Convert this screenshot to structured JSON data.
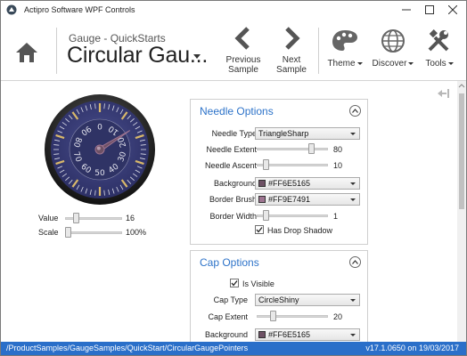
{
  "window": {
    "title": "Actipro Software WPF Controls",
    "icon": "actipro-logo-icon",
    "buttons": [
      "minimize-icon",
      "maximize-icon",
      "close-icon"
    ]
  },
  "ribbon": {
    "home_icon": "home-icon",
    "subtitle": "Gauge - QuickStarts",
    "title": "Circular Gau...",
    "previous_label_1": "Previous",
    "previous_label_2": "Sample",
    "next_label_1": "Next",
    "next_label_2": "Sample",
    "theme_label": "Theme",
    "discover_label": "Discover",
    "tools_label": "Tools"
  },
  "gauge": {
    "numbers": [
      "0",
      "10",
      "20",
      "30",
      "40",
      "50",
      "60",
      "70",
      "80",
      "90"
    ],
    "value": 16
  },
  "controls": {
    "value_label": "Value",
    "value_text": "16",
    "value_fraction": 0.16,
    "scale_label": "Scale",
    "scale_text": "100%",
    "scale_fraction": 0.0
  },
  "needle_options": {
    "title": "Needle Options",
    "type_label": "Needle Type",
    "type_value": "TriangleSharp",
    "extent_label": "Needle Extent",
    "extent_value": "80",
    "extent_fraction": 0.8,
    "ascent_label": "Needle Ascent",
    "ascent_value": "10",
    "ascent_fraction": 0.1,
    "background_label": "Background",
    "background_value": "#FF6E5165",
    "background_color": "#6E5165",
    "border_brush_label": "Border Brush",
    "border_brush_value": "#FF9E7491",
    "border_brush_color": "#9E7491",
    "border_width_label": "Border Width",
    "border_width_value": "1",
    "border_width_fraction": 0.1,
    "shadow_label": "Has Drop Shadow",
    "shadow_checked": true
  },
  "cap_options": {
    "title": "Cap Options",
    "visible_label": "Is Visible",
    "visible_checked": true,
    "type_label": "Cap Type",
    "type_value": "CircleShiny",
    "extent_label": "Cap Extent",
    "extent_value": "20",
    "extent_fraction": 0.2,
    "background_label": "Background",
    "background_value": "#FF6E5165",
    "background_color": "#6E5165"
  },
  "status": {
    "path": "/ProductSamples/GaugeSamples/QuickStart/CircularGaugePointers",
    "version": "v17.1.0650 on 19/03/2017"
  }
}
